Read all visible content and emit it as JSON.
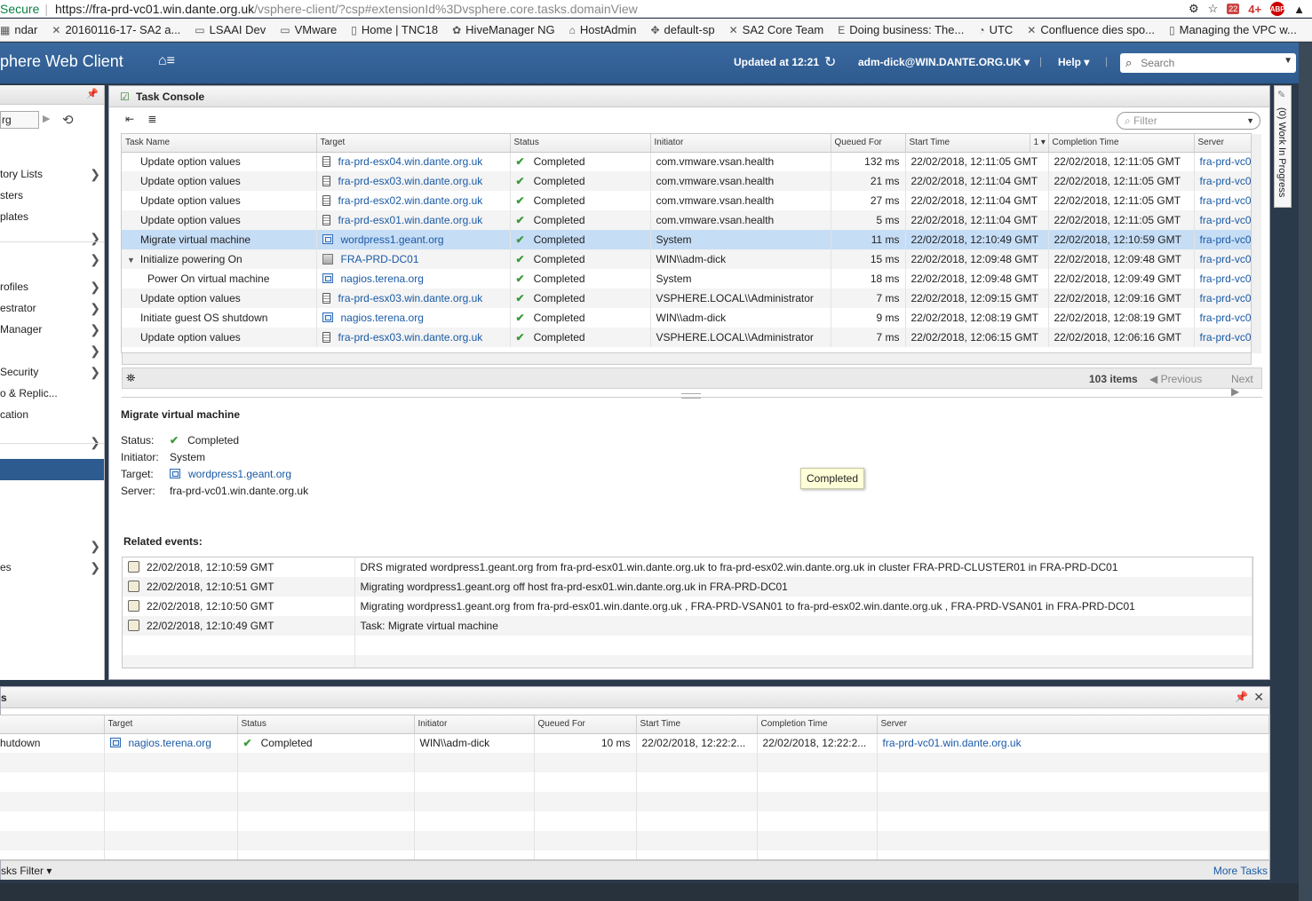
{
  "browser": {
    "secure_label": "Secure",
    "url_host": "https://fra-prd-vc01.win.dante.org.uk",
    "url_path": "/vsphere-client/?csp#extensionId%3Dvsphere.core.tasks.domainView",
    "cal_badge": "22",
    "four_badge": "4+",
    "abp_label": "ABP",
    "bookmarks": [
      {
        "label": "ndar",
        "icon": "calendar-icon"
      },
      {
        "label": "20160116-17- SA2 a...",
        "icon": "x-logo-icon"
      },
      {
        "label": "LSAAI Dev",
        "icon": "folder-icon"
      },
      {
        "label": "VMware",
        "icon": "folder-icon"
      },
      {
        "label": "Home | TNC18",
        "icon": "page-icon"
      },
      {
        "label": "HiveManager NG",
        "icon": "hive-icon"
      },
      {
        "label": "HostAdmin",
        "icon": "house-icon"
      },
      {
        "label": "default-sp",
        "icon": "puzzle-icon"
      },
      {
        "label": "SA2 Core Team",
        "icon": "x-logo-icon"
      },
      {
        "label": "Doing business: The...",
        "icon": "e-logo-icon"
      },
      {
        "label": "UTC",
        "icon": "clock-icon"
      },
      {
        "label": "Confluence dies spo...",
        "icon": "confluence-icon"
      },
      {
        "label": "Managing the VPC w...",
        "icon": "page-icon"
      }
    ]
  },
  "header": {
    "app_title": "phere Web Client",
    "updated": "Updated at 12:21",
    "user": "adm-dick@WIN.DANTE.ORG.UK",
    "help": "Help",
    "search_placeholder": "Search"
  },
  "leftnav": {
    "crumb": "rg",
    "items": [
      {
        "label": "tory Lists",
        "chevron": true
      },
      {
        "label": "sters",
        "chevron": false
      },
      {
        "label": "plates",
        "chevron": false
      },
      {
        "label": "",
        "chevron": true
      },
      {
        "label": "",
        "chevron": true
      },
      {
        "label": "rofiles",
        "chevron": true
      },
      {
        "label": "estrator",
        "chevron": true
      },
      {
        "label": "Manager",
        "chevron": true
      },
      {
        "label": "",
        "chevron": true
      },
      {
        "label": "Security",
        "chevron": true
      },
      {
        "label": "o & Replic...",
        "chevron": false
      },
      {
        "label": "cation",
        "chevron": false
      },
      {
        "label": "",
        "chevron": true
      },
      {
        "label": "",
        "chevron": true
      },
      {
        "label": "es",
        "chevron": true
      }
    ]
  },
  "console": {
    "title": "Task Console",
    "filter_placeholder": "Filter",
    "columns": [
      "Task Name",
      "Target",
      "Status",
      "Initiator",
      "Queued For",
      "Start Time",
      "1 ▾",
      "Completion Time",
      "Server"
    ],
    "rows": [
      {
        "task": "Update option values",
        "indent": 0,
        "expander": false,
        "target": "fra-prd-esx04.win.dante.org.uk",
        "target_type": "host",
        "status": "Completed",
        "initiator": "com.vmware.vsan.health",
        "queued": "132 ms",
        "start": "22/02/2018, 12:11:05 GMT",
        "completion": "22/02/2018, 12:11:05 GMT",
        "server": "fra-prd-vc0"
      },
      {
        "task": "Update option values",
        "indent": 0,
        "expander": false,
        "target": "fra-prd-esx03.win.dante.org.uk",
        "target_type": "host",
        "status": "Completed",
        "initiator": "com.vmware.vsan.health",
        "queued": "21 ms",
        "start": "22/02/2018, 12:11:04 GMT",
        "completion": "22/02/2018, 12:11:05 GMT",
        "server": "fra-prd-vc0"
      },
      {
        "task": "Update option values",
        "indent": 0,
        "expander": false,
        "target": "fra-prd-esx02.win.dante.org.uk",
        "target_type": "host",
        "status": "Completed",
        "initiator": "com.vmware.vsan.health",
        "queued": "27 ms",
        "start": "22/02/2018, 12:11:04 GMT",
        "completion": "22/02/2018, 12:11:05 GMT",
        "server": "fra-prd-vc0"
      },
      {
        "task": "Update option values",
        "indent": 0,
        "expander": false,
        "target": "fra-prd-esx01.win.dante.org.uk",
        "target_type": "host",
        "status": "Completed",
        "initiator": "com.vmware.vsan.health",
        "queued": "5 ms",
        "start": "22/02/2018, 12:11:04 GMT",
        "completion": "22/02/2018, 12:11:05 GMT",
        "server": "fra-prd-vc0"
      },
      {
        "task": "Migrate virtual machine",
        "indent": 0,
        "expander": false,
        "selected": true,
        "target": "wordpress1.geant.org",
        "target_type": "vm",
        "status": "Completed",
        "initiator": "System",
        "queued": "11 ms",
        "start": "22/02/2018, 12:10:49 GMT",
        "completion": "22/02/2018, 12:10:59 GMT",
        "server": "fra-prd-vc0"
      },
      {
        "task": "Initialize powering On",
        "indent": 0,
        "expander": true,
        "target": "FRA-PRD-DC01",
        "target_type": "dc",
        "status": "Completed",
        "initiator": "WIN\\\\adm-dick",
        "queued": "15 ms",
        "start": "22/02/2018, 12:09:48 GMT",
        "completion": "22/02/2018, 12:09:48 GMT",
        "server": "fra-prd-vc0"
      },
      {
        "task": "Power On virtual machine",
        "indent": 1,
        "expander": false,
        "target": "nagios.terena.org",
        "target_type": "vm",
        "status": "Completed",
        "initiator": "System",
        "queued": "18 ms",
        "start": "22/02/2018, 12:09:48 GMT",
        "completion": "22/02/2018, 12:09:49 GMT",
        "server": "fra-prd-vc0"
      },
      {
        "task": "Update option values",
        "indent": 0,
        "expander": false,
        "target": "fra-prd-esx03.win.dante.org.uk",
        "target_type": "host",
        "status": "Completed",
        "initiator": "VSPHERE.LOCAL\\\\Administrator",
        "queued": "7 ms",
        "start": "22/02/2018, 12:09:15 GMT",
        "completion": "22/02/2018, 12:09:16 GMT",
        "server": "fra-prd-vc0"
      },
      {
        "task": "Initiate guest OS shutdown",
        "indent": 0,
        "expander": false,
        "target": "nagios.terena.org",
        "target_type": "vm",
        "status": "Completed",
        "initiator": "WIN\\\\adm-dick",
        "queued": "9 ms",
        "start": "22/02/2018, 12:08:19 GMT",
        "completion": "22/02/2018, 12:08:19 GMT",
        "server": "fra-prd-vc0"
      },
      {
        "task": "Update option values",
        "indent": 0,
        "expander": false,
        "target": "fra-prd-esx03.win.dante.org.uk",
        "target_type": "host",
        "status": "Completed",
        "initiator": "VSPHERE.LOCAL\\\\Administrator",
        "queued": "7 ms",
        "start": "22/02/2018, 12:06:15 GMT",
        "completion": "22/02/2018, 12:06:16 GMT",
        "server": "fra-prd-vc0"
      }
    ],
    "item_count": "103 items",
    "previous": "Previous",
    "next": "Next"
  },
  "details": {
    "title": "Migrate virtual machine",
    "status_label": "Status:",
    "status_value": "Completed",
    "initiator_label": "Initiator:",
    "initiator_value": "System",
    "target_label": "Target:",
    "target_value": "wordpress1.geant.org",
    "server_label": "Server:",
    "server_value": "fra-prd-vc01.win.dante.org.uk",
    "tooltip": "Completed",
    "related_title": "Related events:",
    "events": [
      {
        "time": "22/02/2018, 12:10:59 GMT",
        "message": "DRS migrated  wordpress1.geant.org  from  fra-prd-esx01.win.dante.org.uk  to  fra-prd-esx02.win.dante.org.uk  in cluster  FRA-PRD-CLUSTER01  in  FRA-PRD-DC01"
      },
      {
        "time": "22/02/2018, 12:10:51 GMT",
        "message": "Migrating  wordpress1.geant.org  off host  fra-prd-esx01.win.dante.org.uk  in  FRA-PRD-DC01"
      },
      {
        "time": "22/02/2018, 12:10:50 GMT",
        "message": "Migrating  wordpress1.geant.org  from  fra-prd-esx01.win.dante.org.uk ,  FRA-PRD-VSAN01  to  fra-prd-esx02.win.dante.org.uk ,  FRA-PRD-VSAN01  in  FRA-PRD-DC01"
      },
      {
        "time": "22/02/2018, 12:10:49 GMT",
        "message": "Task: Migrate virtual machine"
      }
    ]
  },
  "rail": {
    "label": "(0) Work In Progress"
  },
  "recent": {
    "title": "s",
    "columns": [
      "",
      "Target",
      "Status",
      "Initiator",
      "Queued For",
      "Start Time",
      "Completion Time",
      "Server"
    ],
    "rows": [
      {
        "task": "hutdown",
        "target": "nagios.terena.org",
        "status": "Completed",
        "initiator": "WIN\\\\adm-dick",
        "queued": "10 ms",
        "start": "22/02/2018, 12:22:2...",
        "completion": "22/02/2018, 12:22:2...",
        "server": "fra-prd-vc01.win.dante.org.uk"
      }
    ],
    "filter_label": "sks Filter ▾",
    "more_tasks": "More Tasks"
  },
  "colors": {
    "header_bg": "#2d5a8f",
    "selected_row": "#c6ddf6",
    "link": "#1a5aa5",
    "check": "#3b9a3b"
  }
}
